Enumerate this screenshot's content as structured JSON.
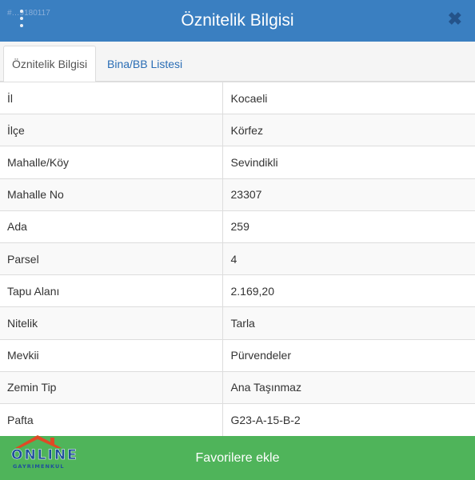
{
  "header": {
    "title": "Öznitelik Bilgisi",
    "id_text": "#…9180117",
    "menu_icon": "kebab-menu-icon",
    "close_icon": "close-icon",
    "close_glyph": "✖"
  },
  "tabs": [
    {
      "label": "Öznitelik Bilgisi",
      "active": true
    },
    {
      "label": "Bina/BB Listesi",
      "active": false
    }
  ],
  "attributes": [
    {
      "key": "İl",
      "value": "Kocaeli"
    },
    {
      "key": "İlçe",
      "value": "Körfez"
    },
    {
      "key": "Mahalle/Köy",
      "value": "Sevindikli"
    },
    {
      "key": "Mahalle No",
      "value": "23307"
    },
    {
      "key": "Ada",
      "value": "259"
    },
    {
      "key": "Parsel",
      "value": "4"
    },
    {
      "key": "Tapu Alanı",
      "value": "2.169,20"
    },
    {
      "key": "Nitelik",
      "value": "Tarla"
    },
    {
      "key": "Mevkii",
      "value": "Pürvendeler"
    },
    {
      "key": "Zemin Tip",
      "value": "Ana Taşınmaz"
    },
    {
      "key": "Pafta",
      "value": "G23-A-15-B-2"
    }
  ],
  "footer": {
    "button_label": "Favorilere ekle"
  },
  "logo": {
    "word": "ONLINE",
    "sub": "GAYRIMENKUL"
  },
  "colors": {
    "header_bg": "#3a7fc1",
    "footer_bg": "#4fb45a",
    "tab_link": "#2a6db5",
    "logo_roof": "#e04a25",
    "logo_text": "#1f4f9c"
  }
}
